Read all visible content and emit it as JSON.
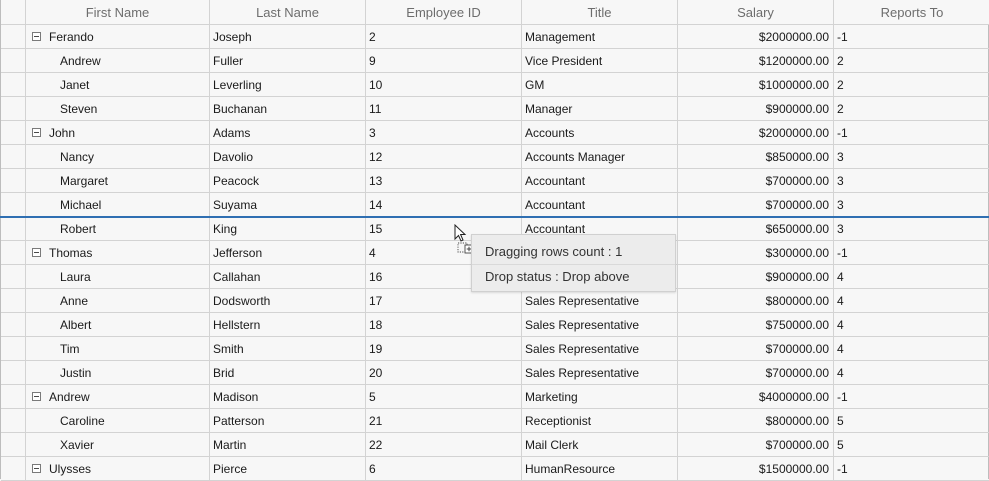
{
  "columns": [
    "First Name",
    "Last Name",
    "Employee ID",
    "Title",
    "Salary",
    "Reports To"
  ],
  "rows": [
    {
      "first": "Ferando",
      "last": "Joseph",
      "id": "2",
      "title": "Management",
      "salary": "$2000000.00",
      "reports": "-1",
      "parent": true
    },
    {
      "first": "Andrew",
      "last": "Fuller",
      "id": "9",
      "title": "Vice President",
      "salary": "$1200000.00",
      "reports": "2",
      "parent": false
    },
    {
      "first": "Janet",
      "last": "Leverling",
      "id": "10",
      "title": "GM",
      "salary": "$1000000.00",
      "reports": "2",
      "parent": false
    },
    {
      "first": "Steven",
      "last": "Buchanan",
      "id": "11",
      "title": "Manager",
      "salary": "$900000.00",
      "reports": "2",
      "parent": false
    },
    {
      "first": "John",
      "last": "Adams",
      "id": "3",
      "title": "Accounts",
      "salary": "$2000000.00",
      "reports": "-1",
      "parent": true
    },
    {
      "first": "Nancy",
      "last": "Davolio",
      "id": "12",
      "title": "Accounts Manager",
      "salary": "$850000.00",
      "reports": "3",
      "parent": false
    },
    {
      "first": "Margaret",
      "last": "Peacock",
      "id": "13",
      "title": "Accountant",
      "salary": "$700000.00",
      "reports": "3",
      "parent": false
    },
    {
      "first": "Michael",
      "last": "Suyama",
      "id": "14",
      "title": "Accountant",
      "salary": "$700000.00",
      "reports": "3",
      "parent": false
    },
    {
      "first": "Robert",
      "last": "King",
      "id": "15",
      "title": "Accountant",
      "salary": "$650000.00",
      "reports": "3",
      "parent": false
    },
    {
      "first": "Thomas",
      "last": "Jefferson",
      "id": "4",
      "title": "",
      "salary": "$300000.00",
      "reports": "-1",
      "parent": true
    },
    {
      "first": "Laura",
      "last": "Callahan",
      "id": "16",
      "title": "",
      "salary": "$900000.00",
      "reports": "4",
      "parent": false
    },
    {
      "first": "Anne",
      "last": "Dodsworth",
      "id": "17",
      "title": "Sales Representative",
      "salary": "$800000.00",
      "reports": "4",
      "parent": false
    },
    {
      "first": "Albert",
      "last": "Hellstern",
      "id": "18",
      "title": "Sales Representative",
      "salary": "$750000.00",
      "reports": "4",
      "parent": false
    },
    {
      "first": "Tim",
      "last": "Smith",
      "id": "19",
      "title": "Sales Representative",
      "salary": "$700000.00",
      "reports": "4",
      "parent": false
    },
    {
      "first": "Justin",
      "last": "Brid",
      "id": "20",
      "title": "Sales Representative",
      "salary": "$700000.00",
      "reports": "4",
      "parent": false
    },
    {
      "first": "Andrew",
      "last": "Madison",
      "id": "5",
      "title": "Marketing",
      "salary": "$4000000.00",
      "reports": "-1",
      "parent": true
    },
    {
      "first": "Caroline",
      "last": "Patterson",
      "id": "21",
      "title": "Receptionist",
      "salary": "$800000.00",
      "reports": "5",
      "parent": false
    },
    {
      "first": "Xavier",
      "last": "Martin",
      "id": "22",
      "title": "Mail Clerk",
      "salary": "$700000.00",
      "reports": "5",
      "parent": false
    },
    {
      "first": "Ulysses",
      "last": "Pierce",
      "id": "6",
      "title": "HumanResource",
      "salary": "$1500000.00",
      "reports": "-1",
      "parent": true
    }
  ],
  "drag_tooltip": {
    "count_label": "Dragging rows count : 1",
    "status_label": "Drop status : Drop above"
  },
  "colors": {
    "drop_line": "#2f6fb2",
    "grid_line": "#d3d3d3",
    "header_text": "#6d6d6d"
  },
  "icons": [
    "collapse-icon",
    "drag-cursor-icon",
    "drag-add-icon"
  ]
}
